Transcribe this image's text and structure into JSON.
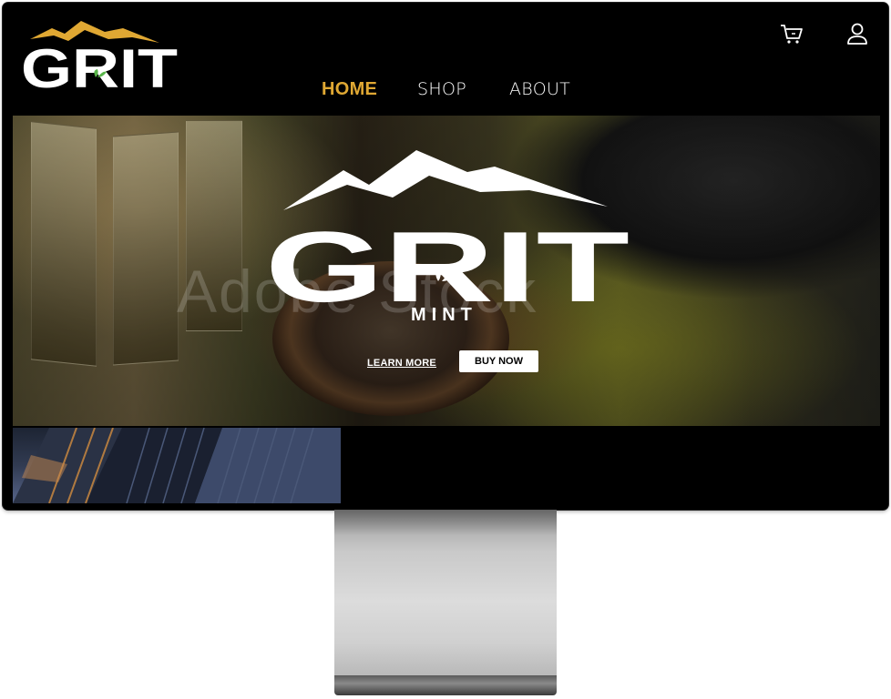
{
  "colors": {
    "accent": "#e0a833",
    "leaf": "#59b54a"
  },
  "brand": {
    "name": "GRIT"
  },
  "nav": {
    "items": [
      {
        "label": "HOME",
        "active": true
      },
      {
        "label": "SHOP",
        "active": false
      },
      {
        "label": "ABOUT",
        "active": false
      }
    ]
  },
  "icons": {
    "cart": "cart-icon",
    "account": "user-icon"
  },
  "hero": {
    "brand": "GRIT",
    "flavor": "MINT",
    "watermark": "Adobe Stock",
    "learn_more": "LEARN MORE",
    "buy_now": "BUY NOW"
  }
}
